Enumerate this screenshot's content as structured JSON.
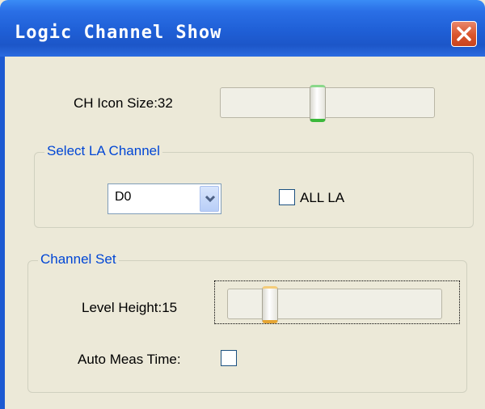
{
  "window": {
    "title": "Logic Channel Show",
    "close_icon": "close-icon"
  },
  "ch_icon_size": {
    "label": "CH Icon Size:32",
    "slider_fraction": 0.47
  },
  "select_la_channel": {
    "legend": "Select LA Channel",
    "combo_value": "D0",
    "all_la_label": "ALL LA",
    "all_la_checked": false
  },
  "channel_set": {
    "legend": "Channel Set",
    "level_height_label": "Level Height:15",
    "level_slider_fraction": 0.2,
    "auto_meas_label": "Auto Meas Time:",
    "auto_meas_checked": false
  },
  "colors": {
    "title_bar": "#1f5fd6",
    "group_legend": "#0046d5",
    "slider_thumb_accent_1": "#3bb83b",
    "slider_thumb_accent_2": "#e5a533"
  }
}
